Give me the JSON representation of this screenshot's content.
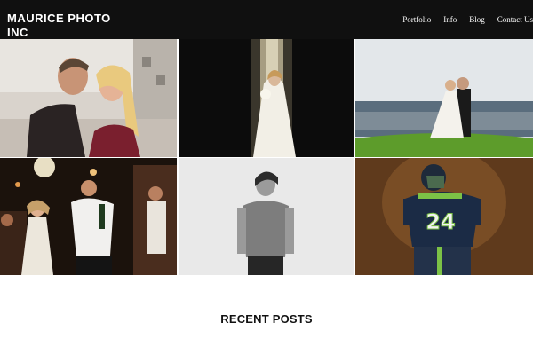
{
  "header": {
    "site_title": "MAURICE PHOTO INC",
    "nav": [
      "Portfolio",
      "Info",
      "Blog",
      "Contact Us"
    ]
  },
  "gallery": {
    "tiles": [
      "couple-portrait",
      "bride-in-doorway",
      "wedding-kiss-on-hill",
      "reception-dance",
      "man-in-t-shirt-portrait",
      "football-player"
    ]
  },
  "sections": {
    "recent_posts": "RECENT POSTS"
  },
  "colors": {
    "header_bg": "#101010",
    "page_bg": "#ffffff",
    "grass": "#5d9c2b"
  }
}
